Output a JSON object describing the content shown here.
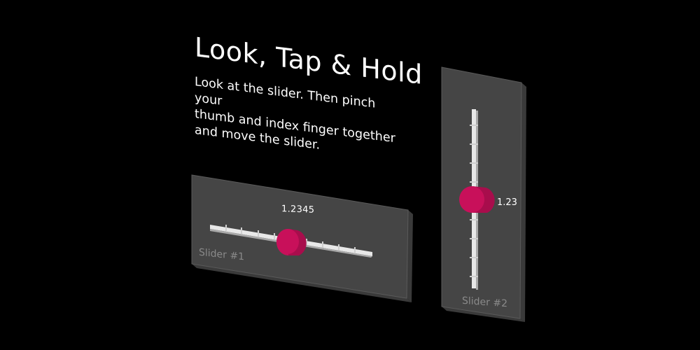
{
  "instructions": {
    "title": "Look, Tap & Hold",
    "body": "Look at the slider. Then pinch your\nthumb and index finger together\nand move the slider."
  },
  "slider1": {
    "label": "Slider #1",
    "value_text": "1.2345",
    "thumb_color": "#c8105a",
    "panel_color": "#454545"
  },
  "slider2": {
    "label": "Slider #2",
    "value_text": "1.23",
    "thumb_color": "#c8105a",
    "panel_color": "#454545"
  }
}
